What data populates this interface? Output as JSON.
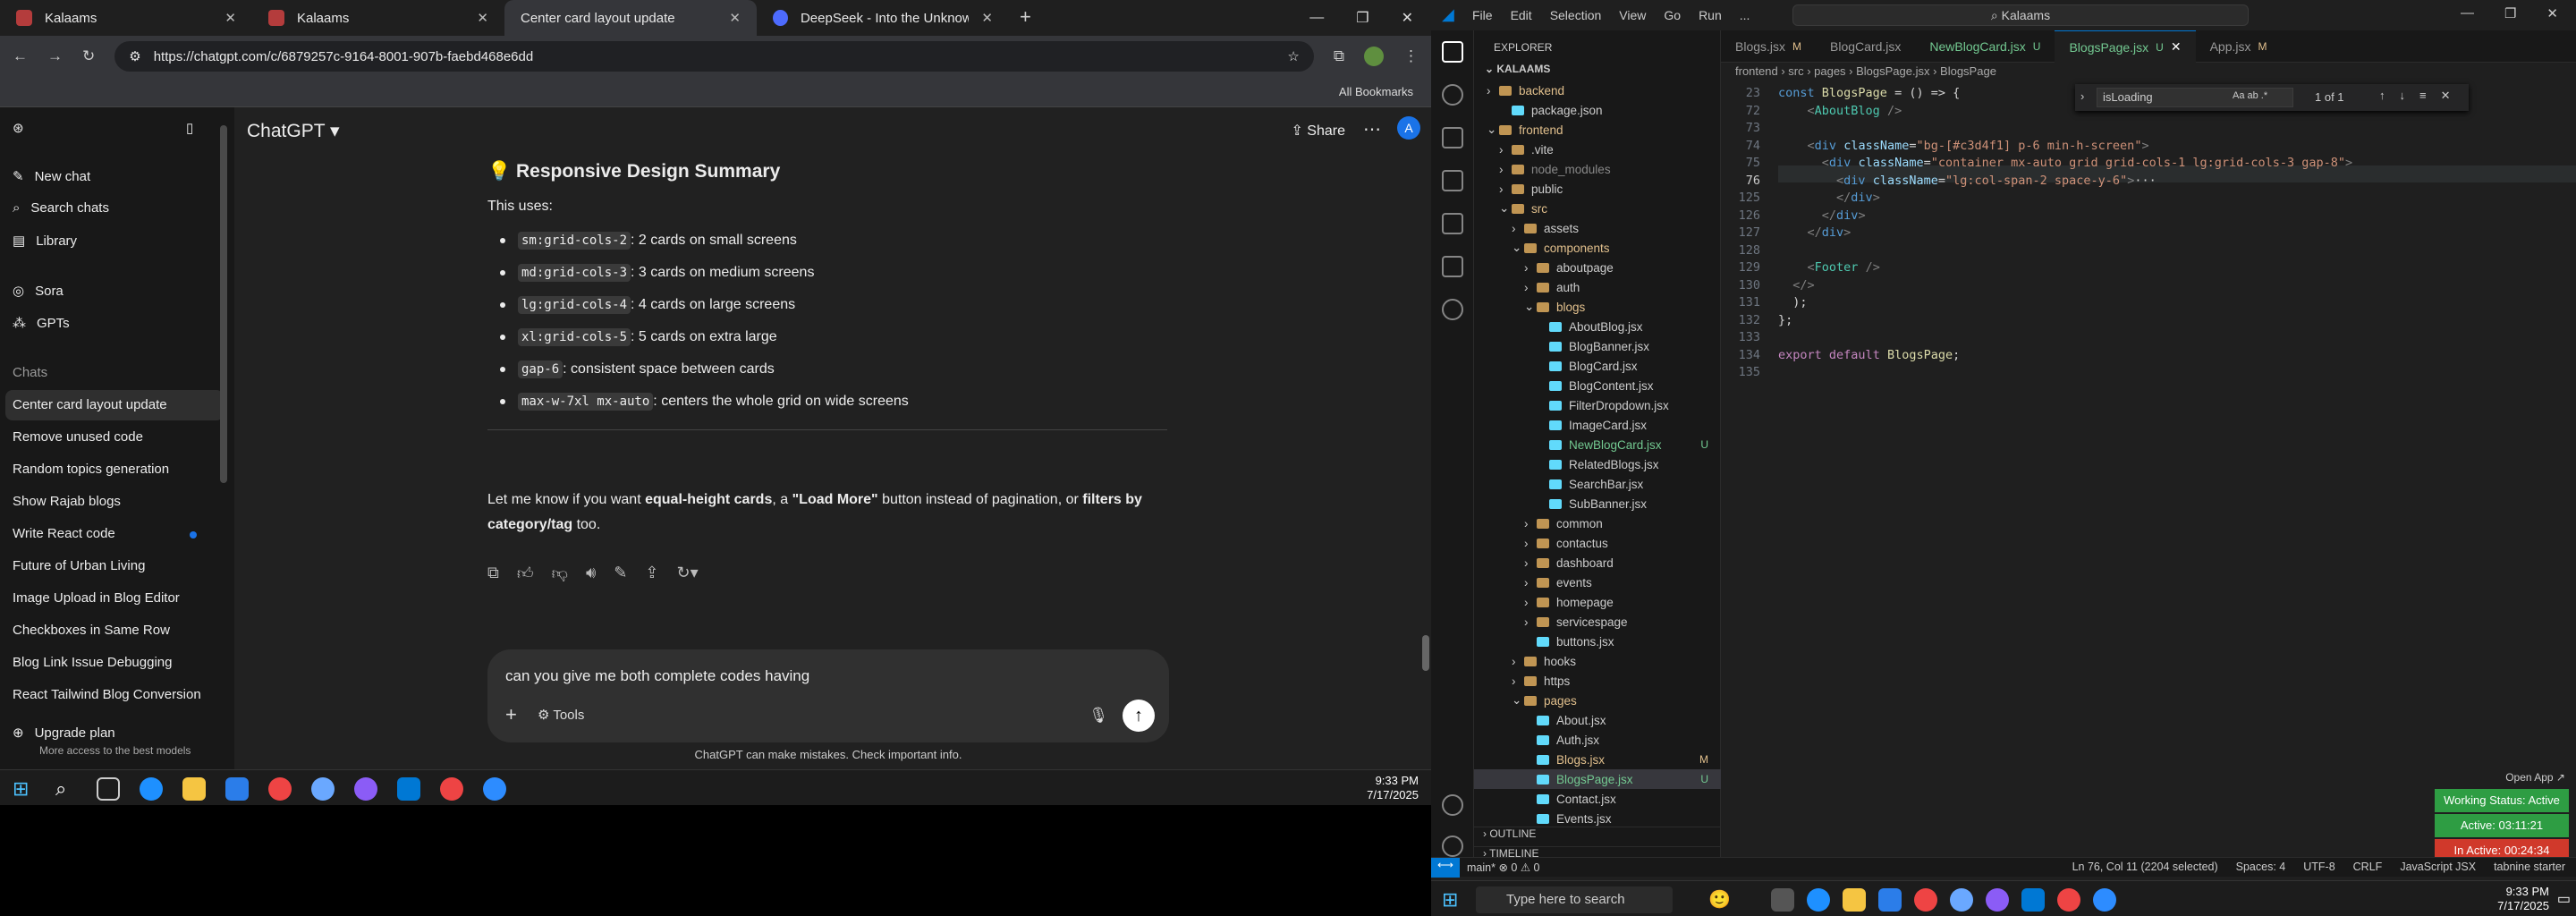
{
  "browser": {
    "tabs": [
      {
        "label": "Kalaams",
        "active": false
      },
      {
        "label": "Kalaams",
        "active": false
      },
      {
        "label": "Center card layout update",
        "active": true
      },
      {
        "label": "DeepSeek - Into the Unknown",
        "active": false
      }
    ],
    "url": "https://chatgpt.com/c/6879257c-9164-8001-907b-faebd468e6dd",
    "bookmarks_label": "All Bookmarks"
  },
  "chatgpt": {
    "model": "ChatGPT ▾",
    "share": "Share",
    "avatar": "A",
    "sidebar": {
      "new_chat": "New chat",
      "search": "Search chats",
      "library": "Library",
      "sora": "Sora",
      "gpts": "GPTs",
      "chats_heading": "Chats",
      "history": [
        "Center card layout update",
        "Remove unused code",
        "Random topics generation",
        "Show Rajab blogs",
        "Write React code",
        "Future of Urban Living",
        "Image Upload in Blog Editor",
        "Checkboxes in Same Row",
        "Blog Link Issue Debugging",
        "React Tailwind Blog Conversion"
      ],
      "upgrade": "Upgrade plan",
      "upgrade_sub": "More access to the best models"
    },
    "message": {
      "heading": "💡 Responsive Design Summary",
      "intro": "This uses:",
      "bullets": [
        {
          "code": "sm:grid-cols-2",
          "text": ": 2 cards on small screens"
        },
        {
          "code": "md:grid-cols-3",
          "text": ": 3 cards on medium screens"
        },
        {
          "code": "lg:grid-cols-4",
          "text": ": 4 cards on large screens"
        },
        {
          "code": "xl:grid-cols-5",
          "text": ": 5 cards on extra large"
        },
        {
          "code": "gap-6",
          "text": ": consistent space between cards"
        },
        {
          "code": "max-w-7xl mx-auto",
          "text": ": centers the whole grid on wide screens"
        }
      ],
      "closing_1a": "Let me know if you want ",
      "closing_1b": "equal-height cards",
      "closing_1c": ", a ",
      "closing_1d": "\"Load More\"",
      "closing_1e": " button instead of pagination, or ",
      "closing_1f": "filters by",
      "closing_2a": "category/tag",
      "closing_2b": " too."
    },
    "composer": {
      "value": "can you give me both complete codes having",
      "tools": "Tools"
    },
    "disclaimer": "ChatGPT can make mistakes. Check important info."
  },
  "taskbar_left": {
    "time": "9:33 PM",
    "date": "7/17/2025"
  },
  "vscode": {
    "menu": [
      "File",
      "Edit",
      "Selection",
      "View",
      "Go",
      "Run",
      "..."
    ],
    "search": "Kalaams",
    "explorer_title": "EXPLORER",
    "root": "KALAAMS",
    "tree": [
      {
        "label": "backend",
        "kind": "folder",
        "indent": 1,
        "open": false,
        "state": "mod",
        "badge": ""
      },
      {
        "label": "package.json",
        "kind": "file",
        "indent": 2,
        "state": "",
        "badge": ""
      },
      {
        "label": "frontend",
        "kind": "folder",
        "indent": 1,
        "open": true,
        "state": "mod",
        "badge": ""
      },
      {
        "label": ".vite",
        "kind": "folder",
        "indent": 2,
        "state": "",
        "badge": ""
      },
      {
        "label": "node_modules",
        "kind": "folder",
        "indent": 2,
        "state": "dim",
        "badge": ""
      },
      {
        "label": "public",
        "kind": "folder",
        "indent": 2,
        "state": "",
        "badge": ""
      },
      {
        "label": "src",
        "kind": "folder",
        "indent": 2,
        "open": true,
        "state": "mod",
        "badge": ""
      },
      {
        "label": "assets",
        "kind": "folder",
        "indent": 3,
        "state": "",
        "badge": ""
      },
      {
        "label": "components",
        "kind": "folder",
        "indent": 3,
        "open": true,
        "state": "mod",
        "badge": ""
      },
      {
        "label": "aboutpage",
        "kind": "folder",
        "indent": 4,
        "state": "",
        "badge": ""
      },
      {
        "label": "auth",
        "kind": "folder",
        "indent": 4,
        "state": "",
        "badge": ""
      },
      {
        "label": "blogs",
        "kind": "folder",
        "indent": 4,
        "open": true,
        "state": "mod",
        "badge": ""
      },
      {
        "label": "AboutBlog.jsx",
        "kind": "file",
        "indent": 5,
        "state": "",
        "badge": ""
      },
      {
        "label": "BlogBanner.jsx",
        "kind": "file",
        "indent": 5,
        "state": "",
        "badge": ""
      },
      {
        "label": "BlogCard.jsx",
        "kind": "file",
        "indent": 5,
        "state": "",
        "badge": ""
      },
      {
        "label": "BlogContent.jsx",
        "kind": "file",
        "indent": 5,
        "state": "",
        "badge": ""
      },
      {
        "label": "FilterDropdown.jsx",
        "kind": "file",
        "indent": 5,
        "state": "",
        "badge": ""
      },
      {
        "label": "ImageCard.jsx",
        "kind": "file",
        "indent": 5,
        "state": "",
        "badge": ""
      },
      {
        "label": "NewBlogCard.jsx",
        "kind": "file",
        "indent": 5,
        "state": "unt",
        "badge": "U"
      },
      {
        "label": "RelatedBlogs.jsx",
        "kind": "file",
        "indent": 5,
        "state": "",
        "badge": ""
      },
      {
        "label": "SearchBar.jsx",
        "kind": "file",
        "indent": 5,
        "state": "",
        "badge": ""
      },
      {
        "label": "SubBanner.jsx",
        "kind": "file",
        "indent": 5,
        "state": "",
        "badge": ""
      },
      {
        "label": "common",
        "kind": "folder",
        "indent": 4,
        "state": "",
        "badge": ""
      },
      {
        "label": "contactus",
        "kind": "folder",
        "indent": 4,
        "state": "",
        "badge": ""
      },
      {
        "label": "dashboard",
        "kind": "folder",
        "indent": 4,
        "state": "",
        "badge": ""
      },
      {
        "label": "events",
        "kind": "folder",
        "indent": 4,
        "state": "",
        "badge": ""
      },
      {
        "label": "homepage",
        "kind": "folder",
        "indent": 4,
        "state": "",
        "badge": ""
      },
      {
        "label": "servicespage",
        "kind": "folder",
        "indent": 4,
        "state": "",
        "badge": ""
      },
      {
        "label": "buttons.jsx",
        "kind": "file",
        "indent": 4,
        "state": "",
        "badge": ""
      },
      {
        "label": "hooks",
        "kind": "folder",
        "indent": 3,
        "state": "",
        "badge": ""
      },
      {
        "label": "https",
        "kind": "folder",
        "indent": 3,
        "state": "",
        "badge": ""
      },
      {
        "label": "pages",
        "kind": "folder",
        "indent": 3,
        "open": true,
        "state": "mod",
        "badge": ""
      },
      {
        "label": "About.jsx",
        "kind": "file",
        "indent": 4,
        "state": "",
        "badge": ""
      },
      {
        "label": "Auth.jsx",
        "kind": "file",
        "indent": 4,
        "state": "",
        "badge": ""
      },
      {
        "label": "Blogs.jsx",
        "kind": "file",
        "indent": 4,
        "state": "mod",
        "badge": "M"
      },
      {
        "label": "BlogsPage.jsx",
        "kind": "file",
        "indent": 4,
        "state": "unt sel",
        "badge": "U"
      },
      {
        "label": "Contact.jsx",
        "kind": "file",
        "indent": 4,
        "state": "",
        "badge": ""
      },
      {
        "label": "Events.jsx",
        "kind": "file",
        "indent": 4,
        "state": "",
        "badge": ""
      }
    ],
    "outline": "OUTLINE",
    "timeline": "TIMELINE",
    "tabs": [
      {
        "label": "Blogs.jsx",
        "mark": "M",
        "active": false
      },
      {
        "label": "BlogCard.jsx",
        "mark": "",
        "active": false
      },
      {
        "label": "NewBlogCard.jsx",
        "mark": "U",
        "active": false
      },
      {
        "label": "BlogsPage.jsx",
        "mark": "U",
        "active": true
      },
      {
        "label": "App.jsx",
        "mark": "M",
        "active": false
      }
    ],
    "breadcrumb": "frontend › src › pages › BlogsPage.jsx › BlogsPage",
    "find": {
      "query": "isLoading",
      "count": "1 of 1",
      "opts": "Aa ab .*"
    },
    "lines": [
      {
        "n": "23",
        "html": "<span class='kw'>const</span> <span class='fn'>BlogsPage</span> = () => {"
      },
      {
        "n": "72",
        "html": "    <span class='pu'>&lt;</span><span class='tg'>AboutBlog</span> <span class='pu'>/&gt;</span>"
      },
      {
        "n": "73",
        "html": ""
      },
      {
        "n": "74",
        "html": "    <span class='pu'>&lt;</span><span class='kw'>div</span> <span class='at'>className</span>=<span class='st'>\"bg-[#c3d4f1] p-6 min-h-screen\"</span><span class='pu'>&gt;</span>"
      },
      {
        "n": "75",
        "html": "      <span class='pu'>&lt;</span><span class='kw'>div</span> <span class='at'>className</span>=<span class='st'>\"container mx-auto grid grid-cols-1 lg:grid-cols-3 gap-8\"</span><span class='pu'>&gt;</span>"
      },
      {
        "n": "76",
        "html": "        <span class='pu'>&lt;</span><span class='kw'>div</span> <span class='at'>className</span>=<span class='st'>\"lg:col-span-2 space-y-6\"</span><span class='pu'>&gt;</span>···"
      },
      {
        "n": "125",
        "html": "        <span class='pu'>&lt;/</span><span class='kw'>div</span><span class='pu'>&gt;</span>"
      },
      {
        "n": "126",
        "html": "      <span class='pu'>&lt;/</span><span class='kw'>div</span><span class='pu'>&gt;</span>"
      },
      {
        "n": "127",
        "html": "    <span class='pu'>&lt;/</span><span class='kw'>div</span><span class='pu'>&gt;</span>"
      },
      {
        "n": "128",
        "html": ""
      },
      {
        "n": "129",
        "html": "    <span class='pu'>&lt;</span><span class='tg'>Footer</span> <span class='pu'>/&gt;</span>"
      },
      {
        "n": "130",
        "html": "  <span class='pu'>&lt;/&gt;</span>"
      },
      {
        "n": "131",
        "html": "  );"
      },
      {
        "n": "132",
        "html": "};"
      },
      {
        "n": "133",
        "html": ""
      },
      {
        "n": "134",
        "html": "<span class='kw2'>export</span> <span class='kw2'>default</span> <span class='fn'>BlogsPage</span>;"
      },
      {
        "n": "135",
        "html": ""
      }
    ],
    "status": {
      "branch": "main*",
      "problems": "⊗ 0 ⚠ 0",
      "position": "Ln 76, Col 11 (2204 selected)",
      "spaces": "Spaces: 4",
      "encoding": "UTF-8",
      "eol": "CRLF",
      "language": "JavaScript JSX",
      "extra": "tabnine starter"
    },
    "open_app": "Open App ↗",
    "tracker": [
      {
        "label": "Working Status: Active",
        "color": "#2e9d43"
      },
      {
        "label": "Active: 03:11:21",
        "color": "#2e9d43"
      },
      {
        "label": "In Active: 00:24:34",
        "color": "#d0392b"
      }
    ]
  },
  "taskbar_right": {
    "search": "Type here to search",
    "time": "9:33 PM",
    "date": "7/17/2025"
  }
}
